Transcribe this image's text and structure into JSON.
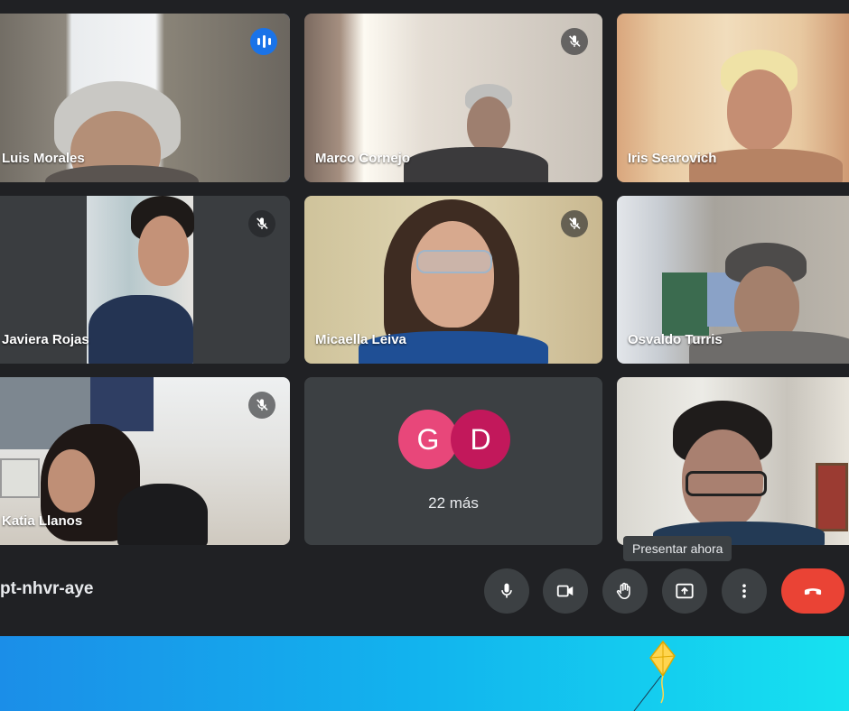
{
  "participants": [
    {
      "name": "Luis Morales",
      "status": "speaking",
      "status_icon": "audio-level-icon"
    },
    {
      "name": "Marco Cornejo",
      "status": "muted",
      "status_icon": "mic-off-icon"
    },
    {
      "name": "Iris Searovich",
      "status": "unmuted"
    },
    {
      "name": "Javiera Rojas",
      "status": "muted",
      "status_icon": "mic-off-icon"
    },
    {
      "name": "Micaella Leiva",
      "status": "muted",
      "status_icon": "mic-off-icon"
    },
    {
      "name": "Osvaldo Turris",
      "status": "unmuted"
    },
    {
      "name": "Katia Llanos",
      "status": "muted",
      "status_icon": "mic-off-icon"
    },
    {
      "name": "",
      "status": "unmuted"
    }
  ],
  "more_tile": {
    "avatars": [
      {
        "initial": "G",
        "color": "#e8477a"
      },
      {
        "initial": "D",
        "color": "#c2185b"
      }
    ],
    "label": "22 más"
  },
  "meeting": {
    "code": "pt-nhvr-aye"
  },
  "controls": {
    "tooltip": "Presentar ahora",
    "buttons": [
      {
        "name": "microphone-button",
        "icon": "mic-icon"
      },
      {
        "name": "camera-button",
        "icon": "videocam-icon"
      },
      {
        "name": "raise-hand-button",
        "icon": "hand-icon"
      },
      {
        "name": "present-now-button",
        "icon": "present-screen-icon"
      },
      {
        "name": "more-options-button",
        "icon": "more-vert-icon"
      },
      {
        "name": "leave-call-button",
        "icon": "call-end-icon",
        "color": "#ea4335"
      }
    ]
  },
  "theme": {
    "background": "#202124",
    "tile": "#3c4043",
    "speaking_border": "#669df6",
    "speaking_badge": "#1a73e8"
  }
}
